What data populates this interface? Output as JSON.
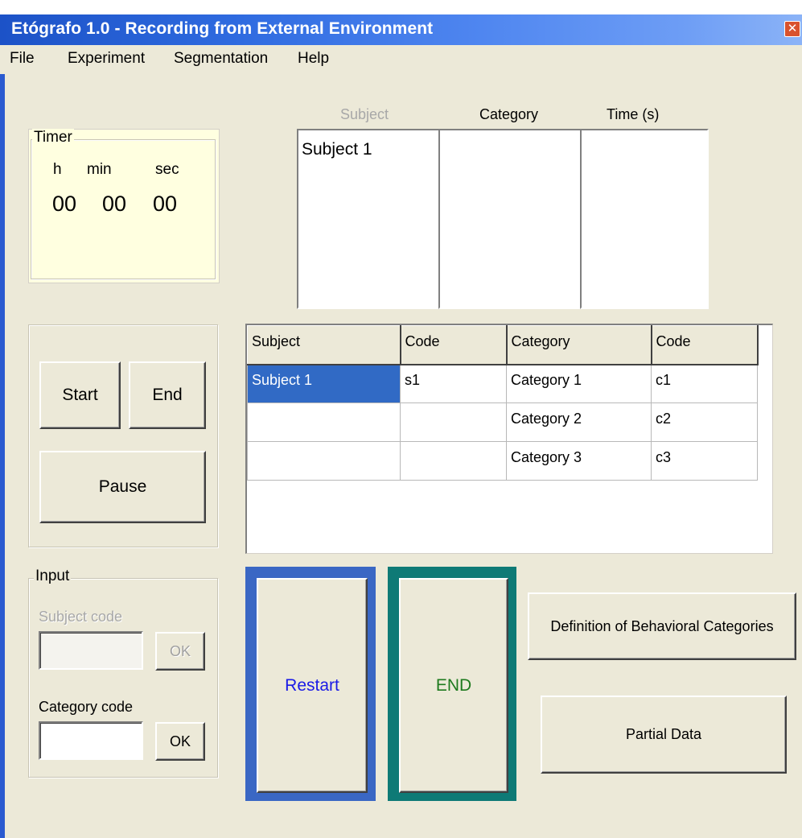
{
  "window": {
    "title": "Etógrafo 1.0 - Recording from External Environment",
    "close_glyph": "✕"
  },
  "menu": {
    "items": [
      "File",
      "Experiment",
      "Segmentation",
      "Help"
    ]
  },
  "timer": {
    "legend": "Timer",
    "h_label": "h",
    "min_label": "min",
    "sec_label": "sec",
    "h": "00",
    "min": "00",
    "sec": "00"
  },
  "log": {
    "headers": {
      "subject": "Subject",
      "category": "Category",
      "time": "Time (s)"
    },
    "subject_items": [
      "Subject 1"
    ],
    "category_items": [],
    "time_items": []
  },
  "controls": {
    "start": "Start",
    "end": "End",
    "pause": "Pause"
  },
  "codes_table": {
    "headers": [
      "Subject",
      "Code",
      "Category",
      "Code"
    ],
    "rows": [
      [
        "Subject 1",
        "s1",
        "Category 1",
        "c1"
      ],
      [
        "",
        "",
        "Category 2",
        "c2"
      ],
      [
        "",
        "",
        "Category 3",
        "c3"
      ]
    ]
  },
  "input": {
    "legend": "Input",
    "subject_code_label": "Subject code",
    "subject_code_value": "",
    "subject_ok": "OK",
    "category_code_label": "Category code",
    "category_code_value": "",
    "category_ok": "OK"
  },
  "actions": {
    "restart": "Restart",
    "end_caps": "END",
    "definition": "Definition of Behavioral Categories",
    "partial": "Partial Data"
  },
  "colors": {
    "restart_frame": "#3a67c4",
    "end_frame": "#0e7a76",
    "restart_text": "#1a1ae6",
    "end_text": "#1e7a1e",
    "selection": "#316ac5"
  }
}
